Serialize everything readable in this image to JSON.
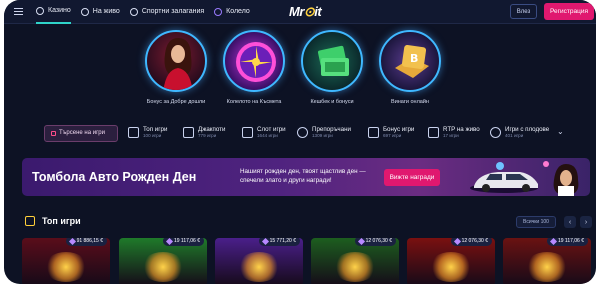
{
  "header": {
    "nav": [
      {
        "label": "Казино",
        "icon": "star-icon"
      },
      {
        "label": "На живо",
        "icon": "person-icon"
      },
      {
        "label": "Спортни залагания",
        "icon": "ball-icon"
      },
      {
        "label": "Колело",
        "icon": "wheel-icon"
      }
    ],
    "logo_left": "Mr",
    "logo_mid": "⊙",
    "logo_right": "it",
    "login_label": "Влез",
    "register_label": "Регистрация"
  },
  "promos": [
    {
      "label": "Бонус за Добре дошли"
    },
    {
      "label": "Колелото на Късмета"
    },
    {
      "label": "Кешбек и бонуси"
    },
    {
      "label": "Винаги онлайн"
    }
  ],
  "categories": {
    "search_label": "Търсене на игри",
    "items": [
      {
        "title": "Топ игри",
        "count": "100 игри"
      },
      {
        "title": "Джакпоти",
        "count": "779 игри"
      },
      {
        "title": "Слот игри",
        "count": "1644 игри"
      },
      {
        "title": "Препоръчани",
        "count": "1309 игри"
      },
      {
        "title": "Бонус игри",
        "count": "697 игри"
      },
      {
        "title": "RTP на живо",
        "count": "17 игри"
      },
      {
        "title": "Игри с плодове",
        "count": "401 игри"
      }
    ]
  },
  "banner": {
    "title": "Томбола Авто Рожден Ден",
    "text": "Нашият рожден ден, твоят щастлив ден — спечели злато и други награди!",
    "button": "Вижте награди"
  },
  "top_games": {
    "title": "Топ игри",
    "all_label": "Всички 100",
    "prev": "‹",
    "next": "›",
    "tiles": [
      {
        "jackpot": "91 886,15 €",
        "color": "#5a0d1a"
      },
      {
        "jackpot": "19 117,06 €",
        "color": "#1f7a2a"
      },
      {
        "jackpot": "15 771,20 €",
        "color": "#4a1f8a"
      },
      {
        "jackpot": "12 076,30 €",
        "color": "#1d5e1f"
      },
      {
        "jackpot": "12 076,30 €",
        "color": "#7a1010"
      },
      {
        "jackpot": "19 117,06 €",
        "color": "#6a1212"
      }
    ]
  },
  "colors": {
    "accent": "#e0186f",
    "teal": "#2fd3c9",
    "bg": "#0d1224"
  }
}
